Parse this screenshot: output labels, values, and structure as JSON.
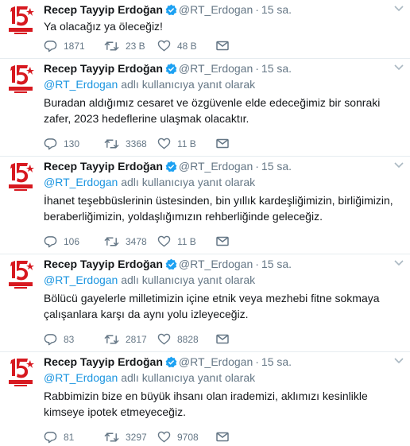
{
  "colors": {
    "accent_link": "#1b95e0",
    "muted_text": "#657786",
    "body_text": "#14171a",
    "divider": "#e6ecf0",
    "verified_badge": "#1da1f2",
    "avatar_red": "#d71920"
  },
  "tweets": [
    {
      "author_name": "Recep Tayyip Erdoğan",
      "handle": "@RT_Erdogan",
      "separator": "·",
      "time": "15 sa.",
      "reply_to": null,
      "text": "Ya olacağız ya öleceğiz!",
      "replies": "1871",
      "retweets": "23 B",
      "likes": "48 B",
      "avatar_icon": "15-temmuz-logo"
    },
    {
      "author_name": "Recep Tayyip Erdoğan",
      "handle": "@RT_Erdogan",
      "separator": "·",
      "time": "15 sa.",
      "reply_to": {
        "mention": "@RT_Erdogan",
        "suffix": " adlı kullanıcıya yanıt olarak"
      },
      "text": "Buradan aldığımız cesaret ve özgüvenle elde edeceğimiz bir sonraki zafer, 2023 hedeflerine ulaşmak olacaktır.",
      "replies": "130",
      "retweets": "3368",
      "likes": "11 B",
      "avatar_icon": "15-temmuz-logo"
    },
    {
      "author_name": "Recep Tayyip Erdoğan",
      "handle": "@RT_Erdogan",
      "separator": "·",
      "time": "15 sa.",
      "reply_to": {
        "mention": "@RT_Erdogan",
        "suffix": " adlı kullanıcıya yanıt olarak"
      },
      "text": "İhanet teşebbüslerinin üstesinden, bin yıllık kardeşliğimizin, birliğimizin, beraberliğimizin, yoldaşlığımızın rehberliğinde geleceğiz.",
      "replies": "106",
      "retweets": "3478",
      "likes": "11 B",
      "avatar_icon": "15-temmuz-logo"
    },
    {
      "author_name": "Recep Tayyip Erdoğan",
      "handle": "@RT_Erdogan",
      "separator": "·",
      "time": "15 sa.",
      "reply_to": {
        "mention": "@RT_Erdogan",
        "suffix": " adlı kullanıcıya yanıt olarak"
      },
      "text": "Bölücü gayelerle milletimizin içine etnik veya mezhebi fitne sokmaya çalışanlara karşı da aynı yolu izleyeceğiz.",
      "replies": "83",
      "retweets": "2817",
      "likes": "8828",
      "avatar_icon": "15-temmuz-logo"
    },
    {
      "author_name": "Recep Tayyip Erdoğan",
      "handle": "@RT_Erdogan",
      "separator": "·",
      "time": "15 sa.",
      "reply_to": {
        "mention": "@RT_Erdogan",
        "suffix": " adlı kullanıcıya yanıt olarak"
      },
      "text": "Rabbimizin bize en büyük ihsanı olan irademizi, aklımızı kesinlikle kimseye ipotek etmeyeceğiz.",
      "replies": "81",
      "retweets": "3297",
      "likes": "9708",
      "avatar_icon": "15-temmuz-logo"
    }
  ]
}
